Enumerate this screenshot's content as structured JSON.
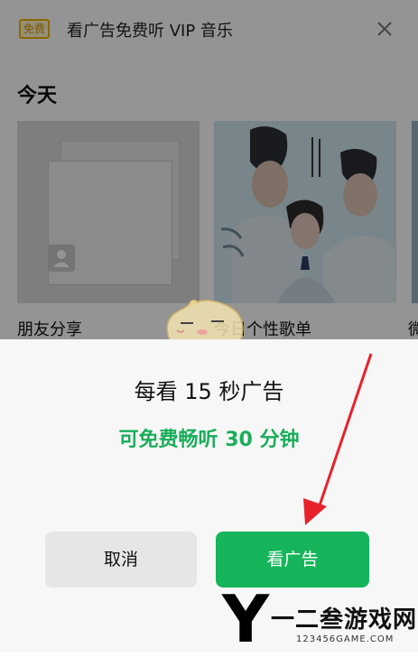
{
  "banner": {
    "badge": "免费",
    "text": "看广告免费听 VIP 音乐",
    "close_icon": "close-icon"
  },
  "section": {
    "title": "今天"
  },
  "cards": [
    {
      "label": "朋友分享"
    },
    {
      "label": "今日个性歌单"
    },
    {
      "label": "微"
    }
  ],
  "dialog": {
    "title": "每看 15 秒广告",
    "subtitle": "可免费畅听 30 分钟",
    "cancel_label": "取消",
    "watch_label": "看广告"
  },
  "watermark": {
    "letter": "Y",
    "title": "一二叁游戏网",
    "url": "123456GAME.COM"
  },
  "colors": {
    "green": "#16b55b",
    "arrow": "#e8222b",
    "badge": "#f3b300"
  }
}
